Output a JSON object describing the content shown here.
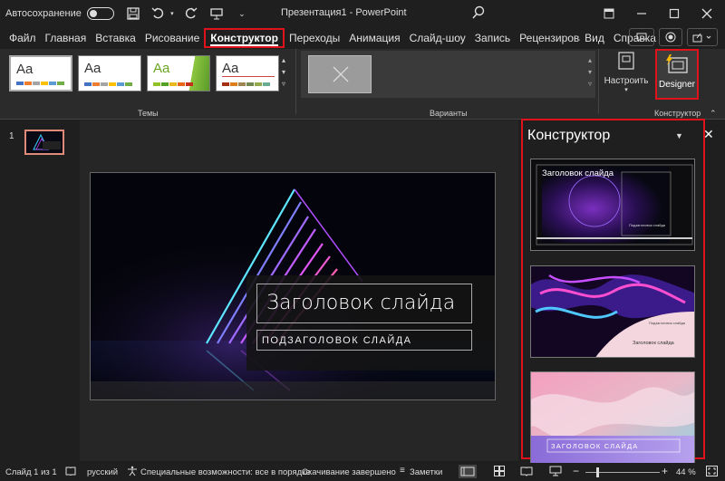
{
  "titlebar": {
    "autosave_label": "Автосохранение",
    "title": "Презентация1  -  PowerPoint"
  },
  "menu": {
    "tabs": [
      "Файл",
      "Главная",
      "Вставка",
      "Рисование",
      "Конструктор",
      "Переходы",
      "Анимация",
      "Слайд-шоу",
      "Запись",
      "Рецензирова",
      "Вид",
      "Справка"
    ],
    "active_tab": "Конструктор"
  },
  "ribbon": {
    "themes_group": "Темы",
    "variants_group": "Варианты",
    "designer_group": "Конструктор",
    "theme_label": "Aa",
    "customize_label": "Настроить",
    "designer_button": "Designer"
  },
  "slides": {
    "number": "1",
    "title": "Заголовок слайда",
    "subtitle": "ПОДЗАГОЛОВОК СЛАЙДА"
  },
  "designer_pane": {
    "title": "Конструктор",
    "card1_title": "Заголовок слайда",
    "card1_sub": "Подзаголовок слайда",
    "card2_sub": "Подзаголовок слайда",
    "card2_title": "Заголовок слайда",
    "card3_title": "ЗАГОЛОВОК СЛАЙДА"
  },
  "status": {
    "slide_info": "Слайд 1 из 1",
    "language": "русский",
    "accessibility": "Специальные возможности: все в порядке",
    "download": "Скачивание завершено",
    "notes": "Заметки",
    "zoom": "44 %"
  },
  "colors": {
    "accent_red": "#e0121b",
    "bg_dark": "#1f1f1f",
    "ribbon_bg": "#2b2b2b"
  }
}
